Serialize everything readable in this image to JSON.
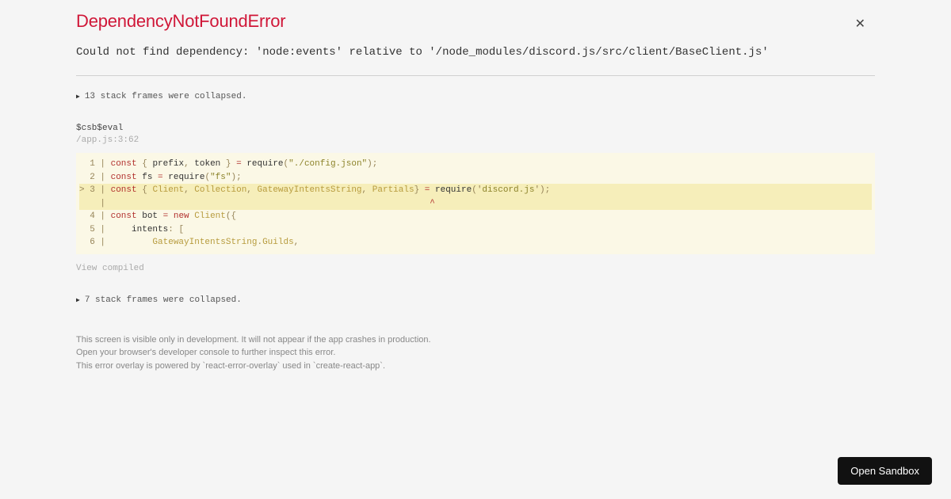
{
  "error": {
    "title": "DependencyNotFoundError",
    "message": "Could not find dependency: 'node:events' relative to '/node_modules/discord.js/src/client/BaseClient.js'"
  },
  "stack": {
    "collapsed_top": "13 stack frames were collapsed.",
    "frame_name": "$csb$eval",
    "frame_location": "/app.js:3:62",
    "collapsed_bottom": "7 stack frames were collapsed."
  },
  "code": {
    "lines": [
      {
        "n": 1,
        "hl": false,
        "tokens": [
          {
            "c": "kw",
            "t": "const"
          },
          {
            "c": "",
            "t": " "
          },
          {
            "c": "punc",
            "t": "{"
          },
          {
            "c": "",
            "t": " prefix"
          },
          {
            "c": "punc",
            "t": ","
          },
          {
            "c": "",
            "t": " token "
          },
          {
            "c": "punc",
            "t": "}"
          },
          {
            "c": "",
            "t": " "
          },
          {
            "c": "op",
            "t": "="
          },
          {
            "c": "",
            "t": " require"
          },
          {
            "c": "punc",
            "t": "("
          },
          {
            "c": "str",
            "t": "\"./config.json\""
          },
          {
            "c": "punc",
            "t": ");"
          }
        ]
      },
      {
        "n": 2,
        "hl": false,
        "tokens": [
          {
            "c": "kw",
            "t": "const"
          },
          {
            "c": "",
            "t": " fs "
          },
          {
            "c": "op",
            "t": "="
          },
          {
            "c": "",
            "t": " require"
          },
          {
            "c": "punc",
            "t": "("
          },
          {
            "c": "str",
            "t": "\"fs\""
          },
          {
            "c": "punc",
            "t": ");"
          }
        ]
      },
      {
        "n": 3,
        "hl": true,
        "prefix": ">",
        "tokens": [
          {
            "c": "kw",
            "t": "const"
          },
          {
            "c": "",
            "t": " "
          },
          {
            "c": "punc",
            "t": "{"
          },
          {
            "c": "",
            "t": " "
          },
          {
            "c": "cls",
            "t": "Client"
          },
          {
            "c": "punc",
            "t": ","
          },
          {
            "c": "",
            "t": " "
          },
          {
            "c": "cls",
            "t": "Collection"
          },
          {
            "c": "punc",
            "t": ","
          },
          {
            "c": "",
            "t": " "
          },
          {
            "c": "cls",
            "t": "GatewayIntentsString"
          },
          {
            "c": "punc",
            "t": ","
          },
          {
            "c": "",
            "t": " "
          },
          {
            "c": "cls",
            "t": "Partials"
          },
          {
            "c": "punc",
            "t": "}"
          },
          {
            "c": "",
            "t": " "
          },
          {
            "c": "op",
            "t": "="
          },
          {
            "c": "",
            "t": " require"
          },
          {
            "c": "punc",
            "t": "('"
          },
          {
            "c": "str",
            "t": "discord.js"
          },
          {
            "c": "punc",
            "t": "');"
          }
        ]
      },
      {
        "n": "",
        "hl": true,
        "prefix": " ",
        "caret": true,
        "tokens": []
      },
      {
        "n": 4,
        "hl": false,
        "tokens": [
          {
            "c": "kw",
            "t": "const"
          },
          {
            "c": "",
            "t": " bot "
          },
          {
            "c": "op",
            "t": "="
          },
          {
            "c": "",
            "t": " "
          },
          {
            "c": "kw",
            "t": "new"
          },
          {
            "c": "",
            "t": " "
          },
          {
            "c": "cls",
            "t": "Client"
          },
          {
            "c": "punc",
            "t": "({"
          }
        ]
      },
      {
        "n": 5,
        "hl": false,
        "tokens": [
          {
            "c": "",
            "t": "    intents"
          },
          {
            "c": "punc",
            "t": ":"
          },
          {
            "c": "",
            "t": " "
          },
          {
            "c": "punc",
            "t": "["
          }
        ]
      },
      {
        "n": 6,
        "hl": false,
        "tokens": [
          {
            "c": "",
            "t": "        "
          },
          {
            "c": "cls",
            "t": "GatewayIntentsString"
          },
          {
            "c": "punc",
            "t": "."
          },
          {
            "c": "cls",
            "t": "Guilds"
          },
          {
            "c": "punc",
            "t": ","
          }
        ]
      }
    ]
  },
  "view_compiled": "View compiled",
  "footer": {
    "line1": "This screen is visible only in development. It will not appear if the app crashes in production.",
    "line2": "Open your browser's developer console to further inspect this error.",
    "line3": "This error overlay is powered by `react-error-overlay` used in `create-react-app`."
  },
  "buttons": {
    "open_sandbox": "Open Sandbox"
  }
}
